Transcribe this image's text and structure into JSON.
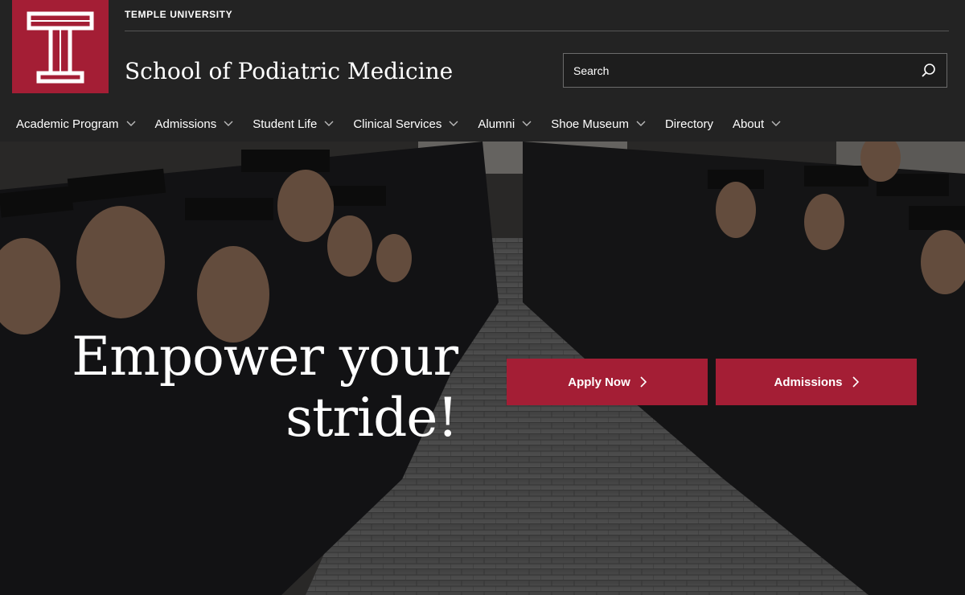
{
  "header": {
    "logo_letter": "T",
    "university": "TEMPLE UNIVERSITY",
    "school": "School of Podiatric Medicine"
  },
  "search": {
    "placeholder": "Search",
    "icon": "search-icon"
  },
  "nav": {
    "items": [
      {
        "label": "Academic Program",
        "has_dropdown": true
      },
      {
        "label": "Admissions",
        "has_dropdown": true
      },
      {
        "label": "Student Life",
        "has_dropdown": true
      },
      {
        "label": "Clinical Services",
        "has_dropdown": true
      },
      {
        "label": "Alumni",
        "has_dropdown": true
      },
      {
        "label": "Shoe Museum",
        "has_dropdown": true
      },
      {
        "label": "Directory",
        "has_dropdown": false
      },
      {
        "label": "About",
        "has_dropdown": true
      }
    ]
  },
  "hero": {
    "headline_line1": "Empower your",
    "headline_line2": "stride!",
    "cta_primary": "Apply Now",
    "cta_secondary": "Admissions"
  },
  "colors": {
    "brand": "#a41e35",
    "header_bg": "#232323"
  }
}
